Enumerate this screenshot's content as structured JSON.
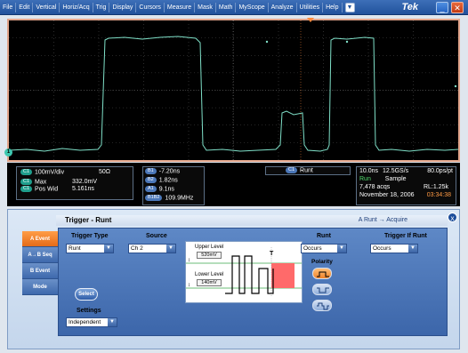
{
  "menu": {
    "items": [
      "File",
      "Edit",
      "Vertical",
      "Horiz/Acq",
      "Trig",
      "Display",
      "Cursors",
      "Measure",
      "Mask",
      "Math",
      "MyScope",
      "Analyze",
      "Utilities",
      "Help"
    ],
    "brand": "Tek"
  },
  "display": {
    "channel_marker": "1"
  },
  "readout": {
    "ch1_scale": "100mV/div",
    "ch1_impedance": "50Ω",
    "c1_label": "C1",
    "max_label": "Max",
    "max_value": "332.0mV",
    "poswid_label": "Pos Wid",
    "poswid_value": "5.161ns",
    "cursor_labels": [
      "B1",
      "B2",
      "A1",
      "B1B2"
    ],
    "cursor_values": [
      "-7.20ns",
      "1.82ns",
      "9.1ns",
      "109.9MHz"
    ],
    "trigger_badge": "C1",
    "trigger_type": "Runt",
    "timebase": "10.0ns",
    "sample_rate": "12.5GS/s",
    "pts_per_div": "80.0ps/pt",
    "run_state": "Run",
    "acq_mode": "Sample",
    "acqs": "7,478 acqs",
    "record_length": "RL:1.25k",
    "date": "November 18, 2006",
    "time": "03:34:38"
  },
  "panel": {
    "title": "Trigger - Runt",
    "state": "A Runt → Acquire",
    "close_label": "x",
    "side_tabs": [
      "A Event",
      "A→B Seq",
      "B Event",
      "Mode"
    ],
    "trigger_type_label": "Trigger Type",
    "trigger_type_value": "Runt",
    "select_label": "Select",
    "settings_label": "Settings",
    "settings_value": "Independent",
    "source_label": "Source",
    "source_value": "Ch 2",
    "upper_level_label": "Upper Level",
    "upper_level_value": "520mV",
    "lower_level_label": "Lower Level",
    "lower_level_value": "140mV",
    "diagram_marker": "T",
    "runt_label": "Runt",
    "runt_value": "Occurs",
    "polarity_label": "Polarity",
    "trigger_if_label": "Trigger If Runt",
    "trigger_if_value": "Occurs"
  },
  "colors": {
    "waveform": "#7fe0c8",
    "accent_orange": "#f0832a",
    "menu_blue": "#21529c",
    "runt_fill": "#ff6a6a"
  }
}
